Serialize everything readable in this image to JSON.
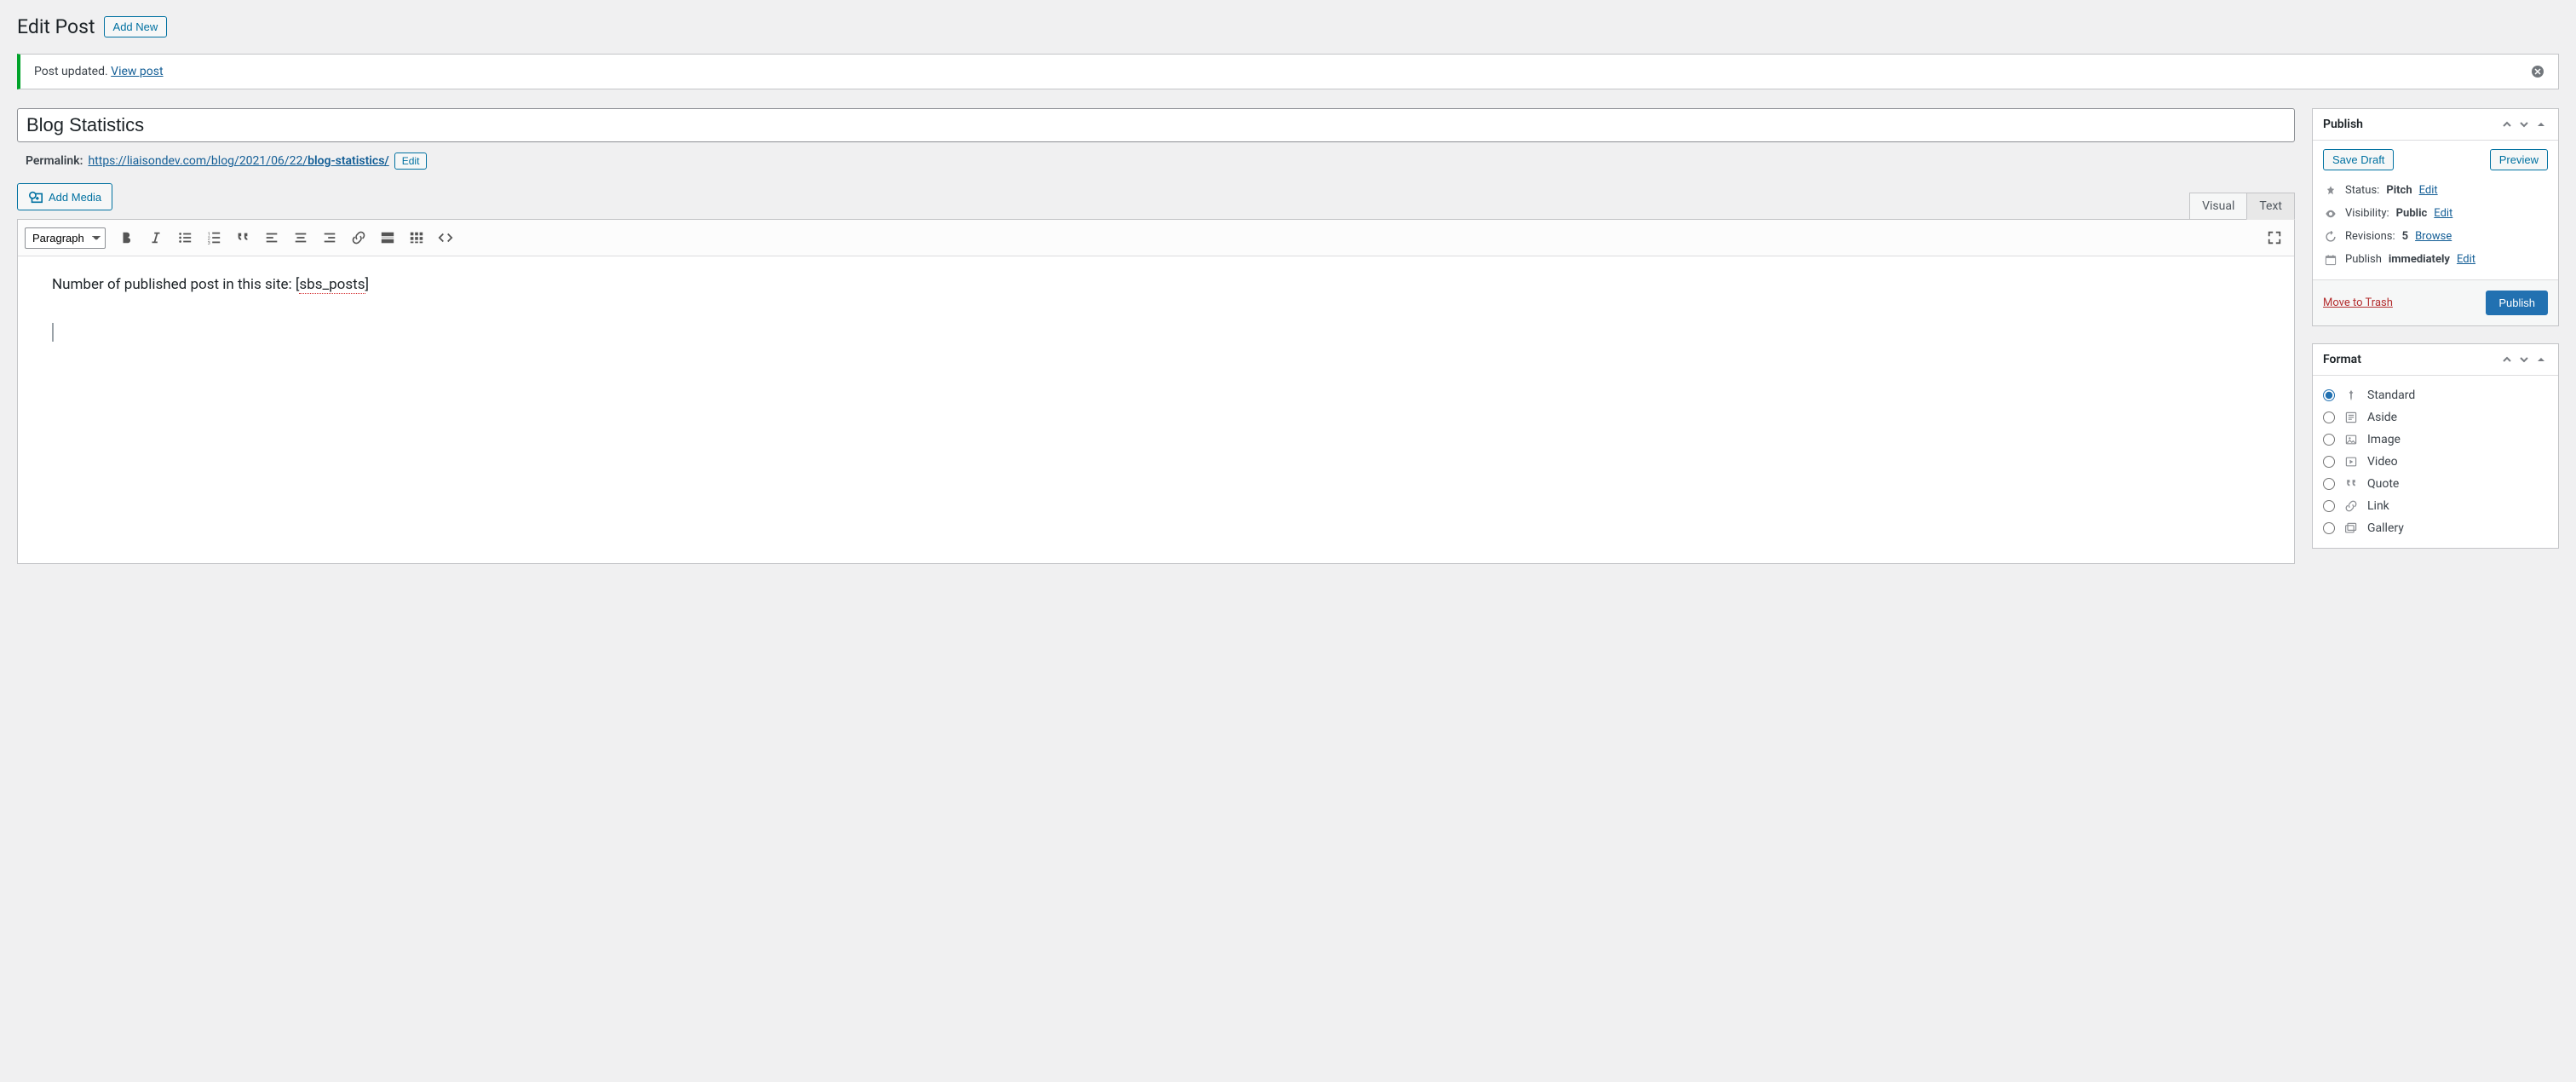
{
  "header": {
    "title": "Edit Post",
    "add_new": "Add New"
  },
  "notice": {
    "text": "Post updated. ",
    "link": "View post"
  },
  "post": {
    "title": "Blog Statistics"
  },
  "permalink": {
    "label": "Permalink:",
    "base": "https://liaisondev.com/blog/2021/06/22/",
    "slug": "blog-statistics/",
    "edit": "Edit"
  },
  "editor": {
    "add_media": "Add Media",
    "tab_visual": "Visual",
    "tab_text": "Text",
    "block_format": "Paragraph",
    "content_prefix": "Number of published post in this site: [",
    "content_shortcode": "sbs_posts",
    "content_suffix": "]"
  },
  "publish": {
    "title": "Publish",
    "save_draft": "Save Draft",
    "preview": "Preview",
    "status_label": "Status: ",
    "status_value": "Pitch",
    "status_edit": "Edit",
    "visibility_label": "Visibility: ",
    "visibility_value": "Public",
    "visibility_edit": "Edit",
    "revisions_label": "Revisions: ",
    "revisions_count": "5",
    "revisions_browse": "Browse",
    "publish_label": "Publish ",
    "publish_value": "immediately",
    "publish_edit": "Edit",
    "trash": "Move to Trash",
    "publish_btn": "Publish"
  },
  "format": {
    "title": "Format",
    "options": [
      {
        "label": "Standard",
        "checked": true
      },
      {
        "label": "Aside",
        "checked": false
      },
      {
        "label": "Image",
        "checked": false
      },
      {
        "label": "Video",
        "checked": false
      },
      {
        "label": "Quote",
        "checked": false
      },
      {
        "label": "Link",
        "checked": false
      },
      {
        "label": "Gallery",
        "checked": false
      }
    ]
  }
}
